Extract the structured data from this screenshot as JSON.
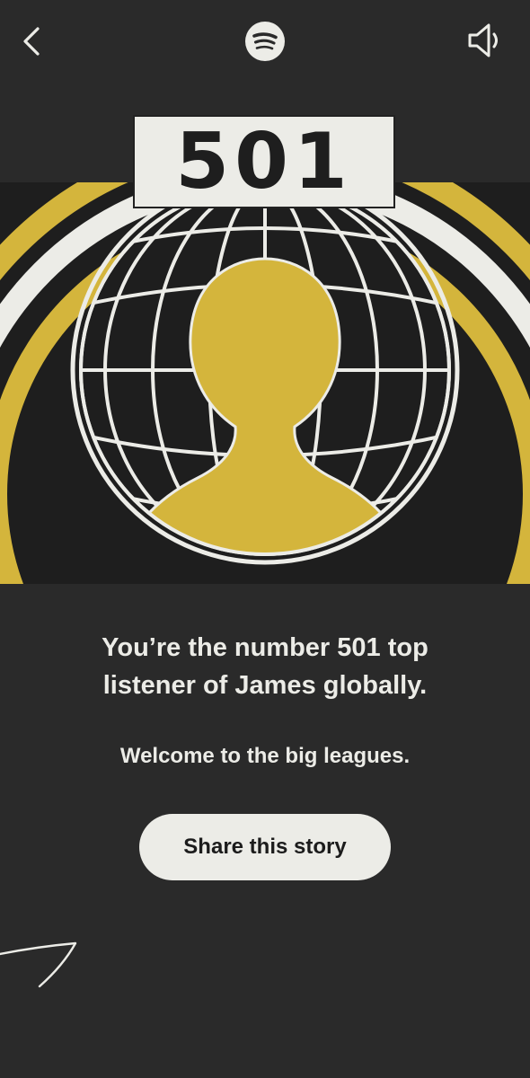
{
  "topbar": {
    "back_icon": "chevron-left-icon",
    "logo_icon": "spotify-logo-icon",
    "sound_icon": "speaker-mute-icon"
  },
  "hero": {
    "rank": "501",
    "colors": {
      "accent": "#d4b53c",
      "light": "#ecece7",
      "dark": "#1e1e1e",
      "background": "#2a2a2a"
    }
  },
  "message": {
    "headline_line1": "You’re the number 501 top",
    "headline_line2": "listener of James globally.",
    "subline": "Welcome to the big leagues."
  },
  "actions": {
    "share_label": "Share this story"
  }
}
